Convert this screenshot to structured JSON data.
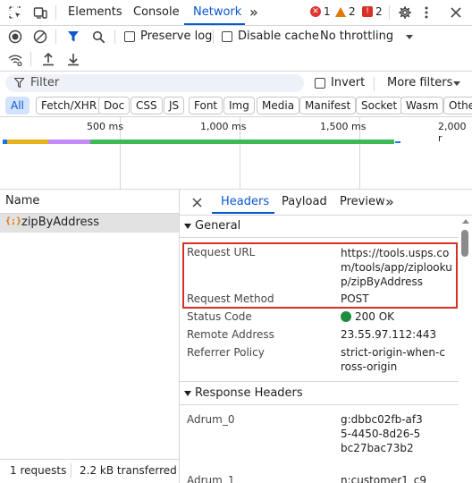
{
  "tabs": {
    "elements": "Elements",
    "console": "Console",
    "network": "Network",
    "more": "»"
  },
  "badges": {
    "errors": "1",
    "warnings": "2",
    "issues": "2"
  },
  "toolbar": {
    "preserve_log": "Preserve log",
    "disable_cache": "Disable cache",
    "throttling": "No throttling"
  },
  "filter": {
    "placeholder": "Filter",
    "invert": "Invert",
    "more_filters": "More filters"
  },
  "type_filters": [
    "All",
    "Fetch/XHR",
    "Doc",
    "CSS",
    "JS",
    "Font",
    "Img",
    "Media",
    "Manifest",
    "Socket",
    "Wasm",
    "Othe"
  ],
  "timeline": {
    "ticks": [
      "500 ms",
      "1,000 ms",
      "1,500 ms",
      "2,000 r"
    ]
  },
  "requests": {
    "column_name": "Name",
    "items": [
      {
        "name": "zipByAddress"
      }
    ],
    "count": "1 requests",
    "transferred": "2.2 kB transferred"
  },
  "details": {
    "tabs": [
      "Headers",
      "Payload",
      "Preview"
    ],
    "more": "»",
    "general": {
      "title": "General",
      "request_url_label": "Request URL",
      "request_url_value": "https://tools.usps.com/tools/app/ziplookup/zipByAddress",
      "request_method_label": "Request Method",
      "request_method_value": "POST",
      "status_code_label": "Status Code",
      "status_code_value": "200 OK",
      "remote_address_label": "Remote Address",
      "remote_address_value": "23.55.97.112:443",
      "referrer_policy_label": "Referrer Policy",
      "referrer_policy_value": "strict-origin-when-cross-origin"
    },
    "response_headers": {
      "title": "Response Headers",
      "adrum0_label": "Adrum_0",
      "adrum0_value": "g:dbbc02fb-af35-4450-8d26-5bc27bac73b2",
      "adrum1_label": "Adrum_1",
      "adrum1_value": "n:customer1_c9"
    }
  },
  "colors": {
    "accent": "#0b57d0",
    "highlight_box": "#d93025",
    "status_ok": "#1e8e3e",
    "error": "#dc362e",
    "warning": "#e37400",
    "issue": "#d93025"
  }
}
